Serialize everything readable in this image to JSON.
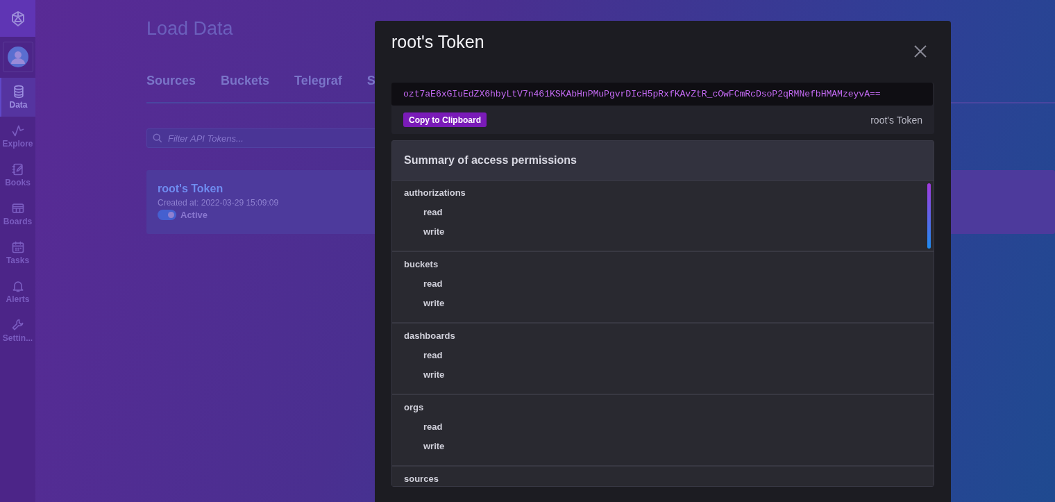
{
  "sidebar": {
    "items": [
      {
        "label": "Data",
        "selected": true
      },
      {
        "label": "Explore",
        "selected": false
      },
      {
        "label": "Books",
        "selected": false
      },
      {
        "label": "Boards",
        "selected": false
      },
      {
        "label": "Tasks",
        "selected": false
      },
      {
        "label": "Alerts",
        "selected": false
      },
      {
        "label": "Settin...",
        "selected": false
      }
    ]
  },
  "page": {
    "title": "Load Data",
    "tabs": [
      {
        "label": "Sources",
        "selected": false
      },
      {
        "label": "Buckets",
        "selected": false
      },
      {
        "label": "Telegraf",
        "selected": false
      },
      {
        "label": "S",
        "selected": false
      }
    ],
    "filter": {
      "placeholder": "Filter API Tokens..."
    },
    "tokens": [
      {
        "name": "root's Token",
        "created": "Created at: 2022-03-29 15:09:09",
        "active": true,
        "status": "Active"
      }
    ]
  },
  "modal": {
    "title": "root's Token",
    "token": "ozt7aE6xGIuEdZX6hbyLtV7n461KSKAbHnPMuPgvrDIcH5pRxfKAvZtR_cOwFCmRcDsoP2qRMNefbHMAMzeyvA==",
    "copy_button": "Copy to Clipboard",
    "token_label": "root's Token",
    "permissions": {
      "title": "Summary of access permissions",
      "groups": [
        {
          "name": "authorizations",
          "actions": [
            "read",
            "write"
          ]
        },
        {
          "name": "buckets",
          "actions": [
            "read",
            "write"
          ]
        },
        {
          "name": "dashboards",
          "actions": [
            "read",
            "write"
          ]
        },
        {
          "name": "orgs",
          "actions": [
            "read",
            "write"
          ]
        },
        {
          "name": "sources"
        }
      ]
    }
  }
}
